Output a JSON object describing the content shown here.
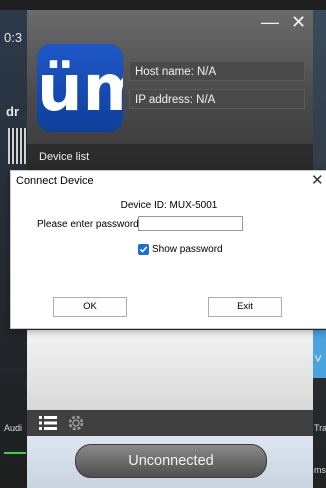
{
  "background": {
    "left_time": "0:3",
    "left_text": "dr",
    "left_audio": "Audi",
    "right_chevron": "˅",
    "right_trans": "Trar",
    "right_ms": "ms"
  },
  "app": {
    "minimize_label": "—",
    "close_label": "✕",
    "logo_text": "üm",
    "host_name": "Host name: N/A",
    "ip_address": "IP address: N/A",
    "device_list_tab": "Device list",
    "toolbar": {
      "list_icon": "list-icon",
      "settings_icon": "gear-icon"
    },
    "connection_status": "Unconnected"
  },
  "dialog": {
    "title": "Connect Device",
    "close": "✕",
    "device_id": "Device ID: MUX-5001",
    "password_label": "Please enter password:",
    "password_value": "",
    "show_password_label": "Show password",
    "show_password_checked": true,
    "ok_label": "OK",
    "exit_label": "Exit"
  },
  "colors": {
    "accent": "#1a6fd6",
    "logo_blue": "#1f57c9"
  }
}
